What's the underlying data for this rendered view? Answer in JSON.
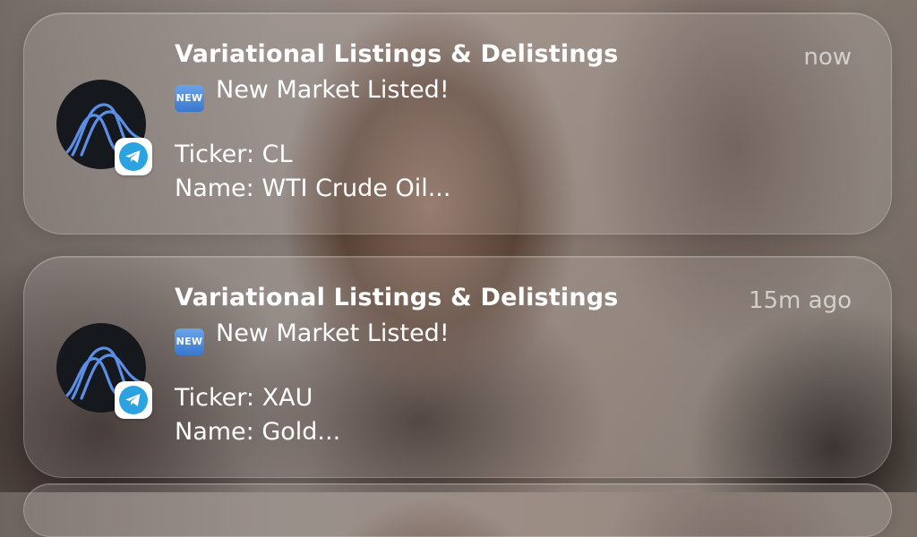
{
  "notifications": [
    {
      "app": "Variational Listings & Delistings",
      "time": "now",
      "badge_icon": "telegram-icon",
      "app_icon": "variational-logo",
      "emoji_text": "NEW",
      "headline": "New Market Listed!",
      "ticker": "Ticker: CL",
      "name": "Name: WTI Crude Oil..."
    },
    {
      "app": "Variational Listings & Delistings",
      "time": "15m ago",
      "badge_icon": "telegram-icon",
      "app_icon": "variational-logo",
      "emoji_text": "NEW",
      "headline": "New Market Listed!",
      "ticker": "Ticker: XAU",
      "name": "Name: Gold..."
    }
  ],
  "colors": {
    "logo_background": "#15181d",
    "logo_stroke": "#5b8fe6",
    "telegram_blue": "#2aa3e0",
    "new_badge": "#3a78cf"
  }
}
